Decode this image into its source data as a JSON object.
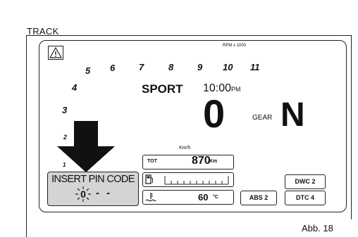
{
  "header": {
    "mode_label": "TRACK"
  },
  "dashboard": {
    "rpm": {
      "unit_label": "RPM x 1000",
      "scale": [
        "1",
        "2",
        "3",
        "4",
        "5",
        "6",
        "7",
        "8",
        "9",
        "10",
        "11"
      ]
    },
    "riding_mode": "SPORT",
    "clock": {
      "time": "10:00",
      "suffix": "PM"
    },
    "speed": {
      "value": "0",
      "unit": "Km/h"
    },
    "gear": {
      "label": "GEAR",
      "value": "N"
    },
    "odometer": {
      "label": "TOT",
      "value": "870",
      "unit": "Km"
    },
    "fuel": {
      "level_fraction": 1.0
    },
    "temperature": {
      "value": "60",
      "unit": "°C"
    },
    "buttons": {
      "abs": "ABS 2",
      "dwc": "DWC 2",
      "dtc": "DTC 4"
    },
    "pin_prompt": {
      "title": "INSERT PIN CODE",
      "digit": "0",
      "remaining": "- -"
    },
    "colors": {
      "pin_background": "#d4d4d4",
      "line": "#222222"
    }
  },
  "caption": "Abb. 18"
}
